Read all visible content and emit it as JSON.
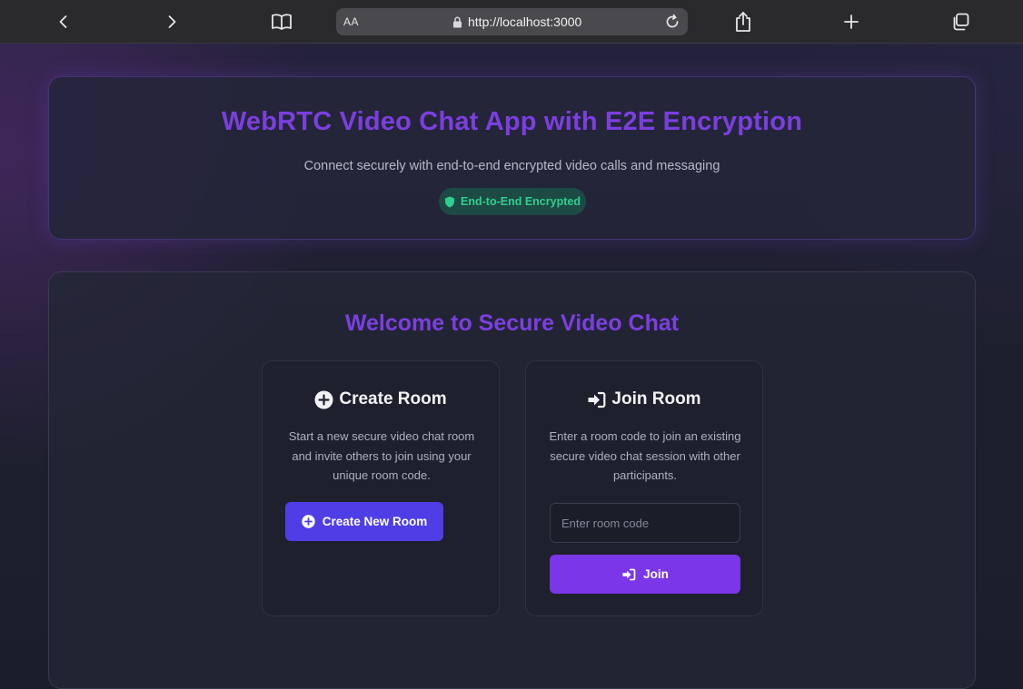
{
  "browser": {
    "text_size_label": "AA",
    "url": "http://localhost:3000",
    "icons": {
      "back": "chevron-left-icon",
      "forward": "chevron-right-icon",
      "bookmarks": "book-icon",
      "lock": "lock-icon",
      "reload": "reload-icon",
      "share": "share-icon",
      "new_tab": "plus-icon",
      "tabs": "tabs-icon"
    }
  },
  "header": {
    "title": "WebRTC Video Chat App with E2E Encryption",
    "subtitle": "Connect securely with end-to-end encrypted video calls and messaging",
    "badge": "End-to-End Encrypted",
    "badge_icon": "shield-icon"
  },
  "main": {
    "welcome": "Welcome to Secure Video Chat",
    "create": {
      "title": "Create Room",
      "title_icon": "plus-circle-icon",
      "description": "Start a new secure video chat room and invite others to join using your unique room code.",
      "button_label": "Create New Room"
    },
    "join": {
      "title": "Join Room",
      "title_icon": "sign-in-icon",
      "description": "Enter a room code to join an existing secure video chat session with other participants.",
      "input_value": "",
      "input_placeholder": "Enter room code",
      "button_label": "Join"
    }
  },
  "colors": {
    "accent_purple": "#7b3fe0",
    "create_button": "#4f3ee6",
    "join_button": "#7a36e8",
    "badge_green": "#2fcf8e"
  }
}
